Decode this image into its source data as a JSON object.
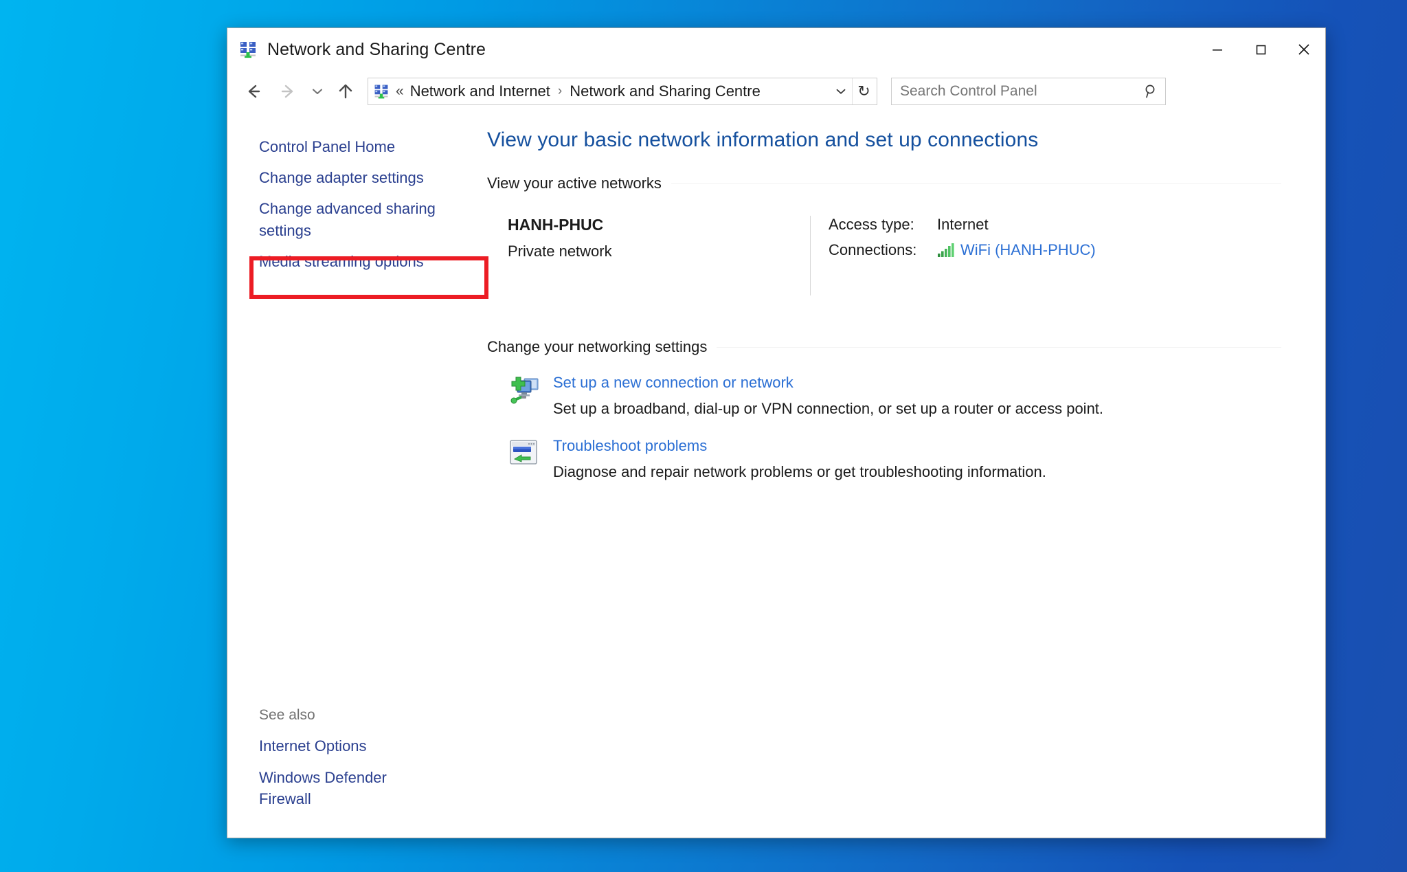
{
  "window": {
    "title": "Network and Sharing Centre",
    "title_icon": "network-sharing-icon",
    "controls": {
      "minimize": "—",
      "maximize": "☐",
      "close": "✕"
    }
  },
  "toolbar": {
    "back_icon": "back-arrow-icon",
    "forward_icon": "forward-arrow-icon",
    "recent_icon": "chevron-down-icon",
    "up_icon": "up-arrow-icon",
    "address": {
      "icon": "network-sharing-icon",
      "separator_leading": "«",
      "crumbs": [
        "Network and Internet",
        "Network and Sharing Centre"
      ],
      "crumb_separator": "›",
      "dropdown_icon": "chevron-down-icon",
      "refresh_icon": "↻"
    },
    "search": {
      "placeholder": "Search Control Panel",
      "value": "",
      "icon": "search-icon"
    }
  },
  "sidebar": {
    "items": [
      {
        "label": "Control Panel Home",
        "highlighted": false
      },
      {
        "label": "Change adapter settings",
        "highlighted": true
      },
      {
        "label": "Change advanced sharing settings",
        "highlighted": false
      },
      {
        "label": "Media streaming options",
        "highlighted": false
      }
    ],
    "highlight_color": "#ec1c24",
    "see_also": {
      "title": "See also",
      "items": [
        "Internet Options",
        "Windows Defender Firewall"
      ]
    }
  },
  "main": {
    "page_title": "View your basic network information and set up connections",
    "active_networks": {
      "heading": "View your active networks",
      "network_name": "HANH-PHUC",
      "network_type": "Private network",
      "details": [
        {
          "key": "Access type:",
          "value": "Internet",
          "is_link": false,
          "icon": null
        },
        {
          "key": "Connections:",
          "value": "WiFi (HANH-PHUC)",
          "is_link": true,
          "icon": "wifi-signal-icon"
        }
      ]
    },
    "change_settings": {
      "heading": "Change your networking settings",
      "tasks": [
        {
          "icon": "new-connection-icon",
          "link": "Set up a new connection or network",
          "description": "Set up a broadband, dial-up or VPN connection, or set up a router or access point."
        },
        {
          "icon": "troubleshoot-icon",
          "link": "Troubleshoot problems",
          "description": "Diagnose and repair network problems or get troubleshooting information."
        }
      ]
    }
  },
  "colors": {
    "link": "#2b6fd4",
    "sidebar_link": "#2a3f8f",
    "title": "#15509e",
    "highlight": "#ec1c24",
    "desktop_left": "#00b4f0",
    "desktop_right": "#1a4fb0"
  }
}
